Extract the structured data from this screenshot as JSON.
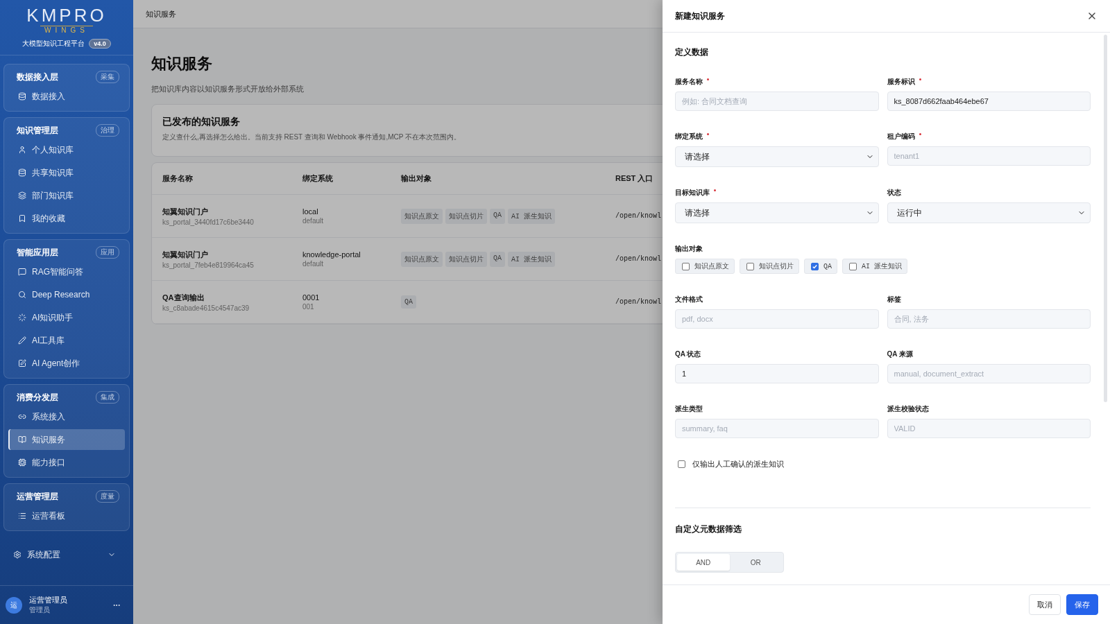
{
  "sidebar": {
    "logo": {
      "title": "KMPRO",
      "subtitle": "WINGS"
    },
    "platform": "大模型知识工程平台",
    "version": "v4.0",
    "groups": [
      {
        "title": "数据接入层",
        "tag": "采集",
        "items": [
          {
            "label": "数据接入",
            "selected": false
          }
        ]
      },
      {
        "title": "知识管理层",
        "tag": "治理",
        "items": [
          {
            "label": "个人知识库",
            "selected": false
          },
          {
            "label": "共享知识库",
            "selected": false
          },
          {
            "label": "部门知识库",
            "selected": false
          },
          {
            "label": "我的收藏",
            "selected": false
          }
        ]
      },
      {
        "title": "智能应用层",
        "tag": "应用",
        "items": [
          {
            "label": "RAG智能问答",
            "selected": false
          },
          {
            "label": "Deep Research",
            "selected": false
          },
          {
            "label": "AI知识助手",
            "selected": false
          },
          {
            "label": "AI工具库",
            "selected": false
          },
          {
            "label": "AI Agent创作",
            "selected": false
          }
        ]
      },
      {
        "title": "消费分发层",
        "tag": "集成",
        "items": [
          {
            "label": "系统接入",
            "selected": false
          },
          {
            "label": "知识服务",
            "selected": true
          },
          {
            "label": "能力接口",
            "selected": false
          }
        ]
      },
      {
        "title": "运营管理层",
        "tag": "度量",
        "items": [
          {
            "label": "运营看板",
            "selected": false
          }
        ]
      }
    ],
    "settings": {
      "label": "系统配置",
      "expanded": false
    },
    "user": {
      "avatar": "运",
      "name": "运营管理员",
      "role": "管理员"
    }
  },
  "breadcrumb": "知识服务",
  "page": {
    "title": "知识服务",
    "subtitle": "把知识库内容以知识服务形式开放给外部系统"
  },
  "intro_card": {
    "title": "已发布的知识服务",
    "description": "定义查什么,再选择怎么给出。当前支持 REST 查询和 Webhook 事件通知,MCP 不在本次范围内。"
  },
  "table": {
    "columns": [
      "服务名称",
      "绑定系统",
      "输出对象",
      "REST 入口"
    ],
    "rows": [
      {
        "name": "知翼知识门户",
        "id": "ks_portal_3440fd17c6be3440",
        "system": "local",
        "system_sub": "default",
        "outputs": [
          "知识点原文",
          "知识点切片",
          "QA",
          "AI 派生知识"
        ],
        "rest": "/open/knowl"
      },
      {
        "name": "知翼知识门户",
        "id": "ks_portal_7feb4e819964ca45",
        "system": "knowledge-portal",
        "system_sub": "default",
        "outputs": [
          "知识点原文",
          "知识点切片",
          "QA",
          "AI 派生知识"
        ],
        "rest": "/open/knowl"
      },
      {
        "name": "QA查询输出",
        "id": "ks_c8abade4615c4547ac39",
        "system": "0001",
        "system_sub": "001",
        "outputs": [
          "QA"
        ],
        "rest": "/open/knowl"
      }
    ]
  },
  "drawer": {
    "title": "新建知识服务",
    "section": "定义数据",
    "fields_top": [
      {
        "label": "服务名称",
        "required": true,
        "kind": "input",
        "placeholder": "例如: 合同文档查询"
      },
      {
        "label": "服务标识",
        "required": true,
        "kind": "input",
        "value": "ks_8087d662faab464ebe67"
      },
      {
        "label": "绑定系统",
        "required": true,
        "kind": "select",
        "value": "请选择"
      },
      {
        "label": "租户编码",
        "required": true,
        "kind": "input",
        "placeholder": "tenant1"
      },
      {
        "label": "目标知识库",
        "required": true,
        "kind": "select",
        "value": "请选择"
      },
      {
        "label": "状态",
        "required": false,
        "kind": "select",
        "value": "运行中"
      }
    ],
    "output_objects": {
      "label": "输出对象",
      "options": [
        {
          "label": "知识点原文",
          "checked": false
        },
        {
          "label": "知识点切片",
          "checked": false
        },
        {
          "label": "QA",
          "checked": true
        },
        {
          "label": "AI 派生知识",
          "checked": false
        }
      ]
    },
    "fields_bottom": [
      {
        "label": "文件格式",
        "required": false,
        "kind": "input",
        "placeholder": "pdf, docx"
      },
      {
        "label": "标签",
        "required": false,
        "kind": "input",
        "placeholder": "合同, 法务"
      },
      {
        "label": "QA 状态",
        "required": false,
        "kind": "input",
        "value": "1"
      },
      {
        "label": "QA 来源",
        "required": false,
        "kind": "input",
        "placeholder": "manual, document_extract"
      },
      {
        "label": "派生类型",
        "required": false,
        "kind": "input",
        "placeholder": "summary, faq"
      },
      {
        "label": "派生校验状态",
        "required": false,
        "kind": "input",
        "placeholder": "VALID"
      }
    ],
    "confirmed_only": {
      "label": "仅输出人工确认的派生知识",
      "checked": false
    },
    "filter": {
      "title": "自定义元数据筛选",
      "logic": [
        {
          "label": "AND",
          "selected": true
        },
        {
          "label": "OR",
          "selected": false
        }
      ]
    },
    "buttons": {
      "cancel": "取消",
      "save": "保存"
    }
  }
}
